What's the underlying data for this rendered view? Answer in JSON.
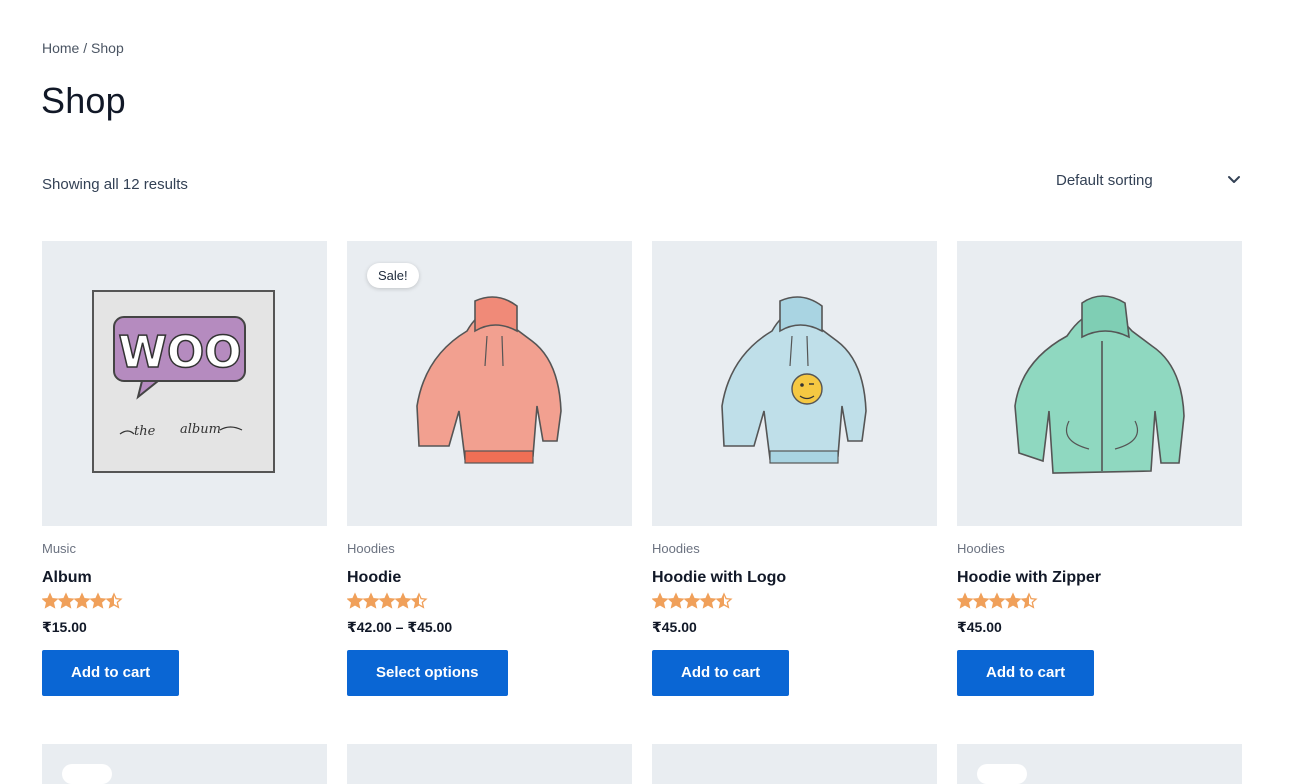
{
  "breadcrumb": {
    "home": "Home",
    "sep": " / ",
    "current": "Shop"
  },
  "page_title": "Shop",
  "result_count": "Showing all 12 results",
  "sorting": {
    "selected": "Default sorting",
    "icon": "chevron-down-icon"
  },
  "colors": {
    "button": "#0a66d4",
    "star": "#f0a05a",
    "thumb_bg": "#e9edf1"
  },
  "products": [
    {
      "category": "Music",
      "name": "Album",
      "price": "₹15.00",
      "rating": 4.5,
      "button": "Add to cart",
      "sale": ""
    },
    {
      "category": "Hoodies",
      "name": "Hoodie",
      "price": "₹42.00 – ₹45.00",
      "rating": 4.5,
      "button": "Select options",
      "sale": "Sale!"
    },
    {
      "category": "Hoodies",
      "name": "Hoodie with Logo",
      "price": "₹45.00",
      "rating": 4.5,
      "button": "Add to cart",
      "sale": ""
    },
    {
      "category": "Hoodies",
      "name": "Hoodie with Zipper",
      "price": "₹45.00",
      "rating": 4.5,
      "button": "Add to cart",
      "sale": ""
    }
  ]
}
